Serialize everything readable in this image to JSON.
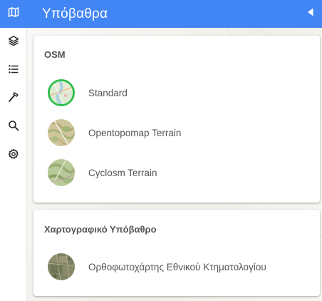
{
  "header": {
    "title": "Υπόβαθρα",
    "color": "#4285f4"
  },
  "rail": {
    "icons": [
      "map-icon",
      "layers-icon",
      "list-icon",
      "hammer-icon",
      "search-icon",
      "gear-icon"
    ]
  },
  "sections": [
    {
      "title": "OSM",
      "layers": [
        {
          "label": "Standard",
          "selected": true
        },
        {
          "label": "Opentopomap Terrain",
          "selected": false
        },
        {
          "label": "Cyclosm Terrain",
          "selected": false
        }
      ]
    },
    {
      "title": "Χαρτογραφικό Υπόβαθρο",
      "layers": [
        {
          "label": "Ορθοφωτοχάρτης Εθνικού Κτηματολογίου",
          "selected": false
        }
      ]
    }
  ],
  "colors": {
    "accent": "#4285f4",
    "selected_ring": "#2fbf4e",
    "text": "#555555"
  }
}
